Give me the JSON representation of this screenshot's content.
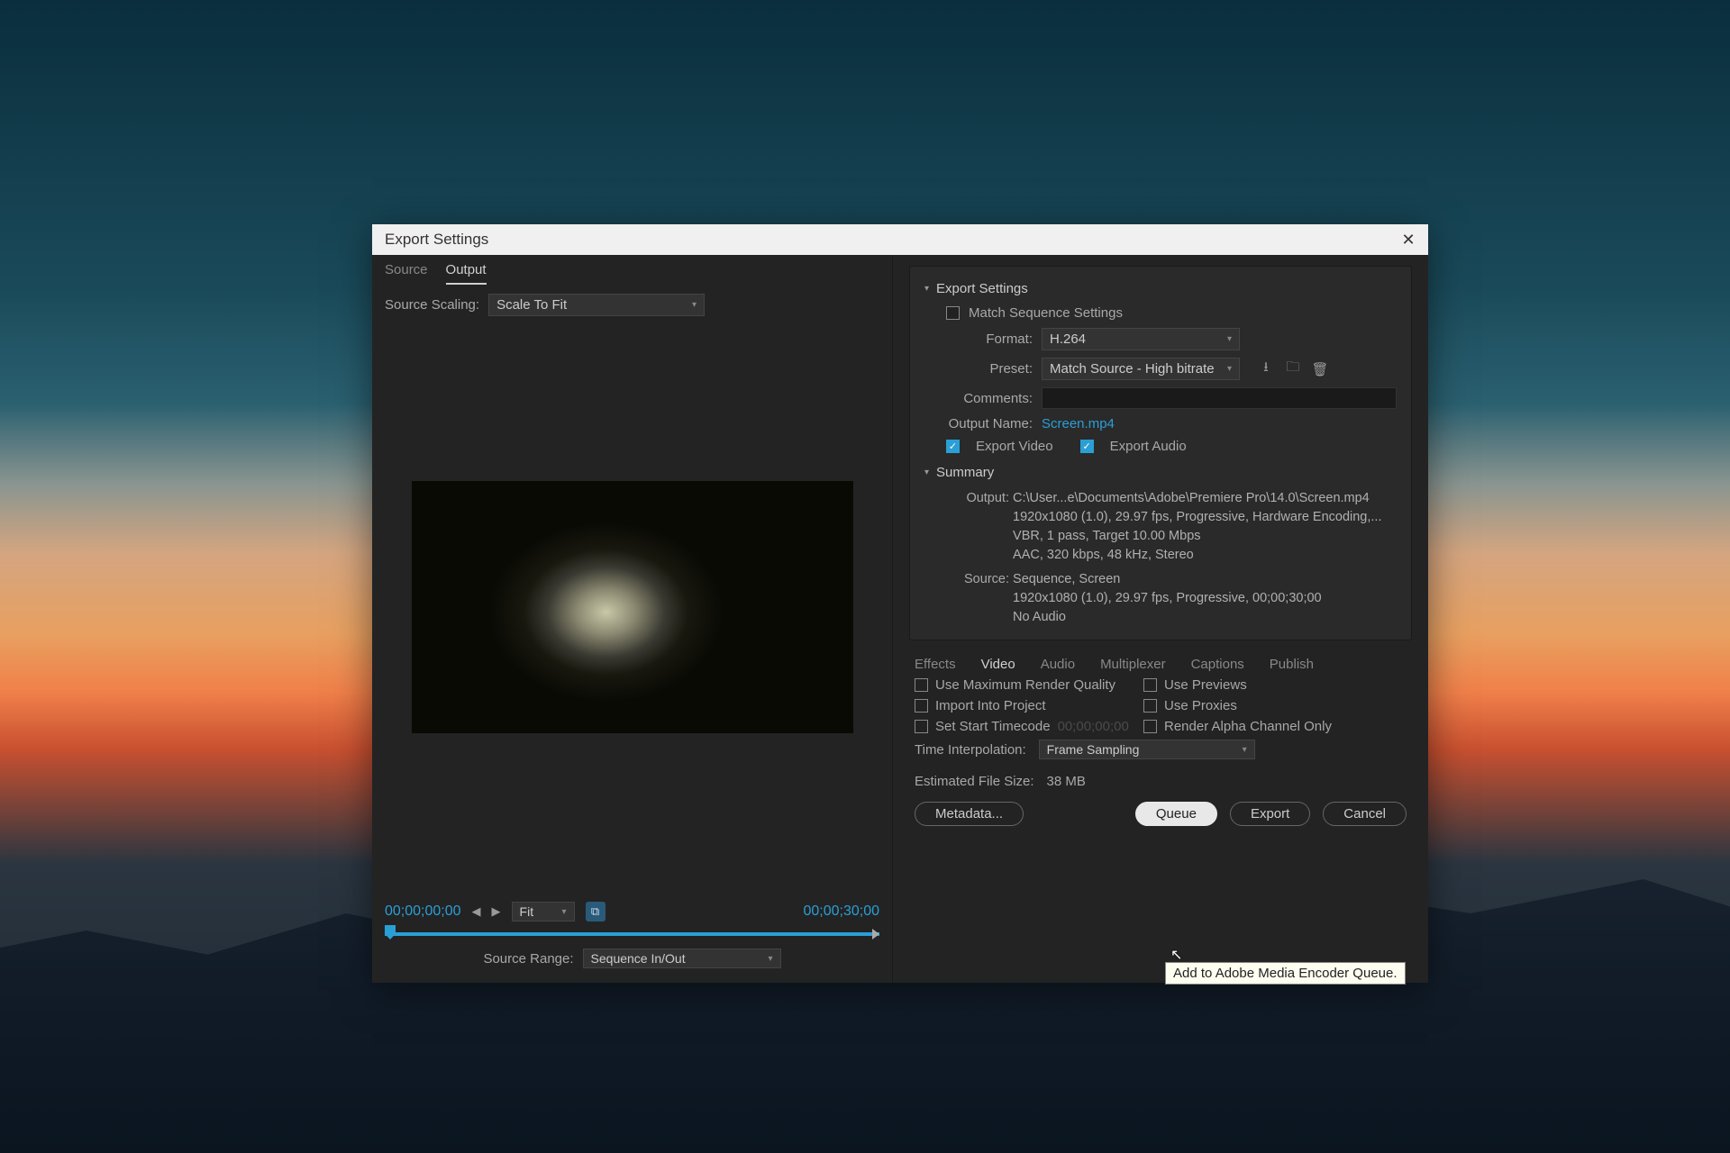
{
  "titlebar": {
    "title": "Export Settings"
  },
  "left": {
    "tabs": {
      "source": "Source",
      "output": "Output"
    },
    "sourceScalingLabel": "Source Scaling:",
    "sourceScalingValue": "Scale To Fit",
    "timecodeStart": "00;00;00;00",
    "timecodeEnd": "00;00;30;00",
    "fitLabel": "Fit",
    "sourceRangeLabel": "Source Range:",
    "sourceRangeValue": "Sequence In/Out"
  },
  "right": {
    "header": "Export Settings",
    "matchSeqLabel": "Match Sequence Settings",
    "formatLabel": "Format:",
    "formatValue": "H.264",
    "presetLabel": "Preset:",
    "presetValue": "Match Source - High bitrate",
    "commentsLabel": "Comments:",
    "outputNameLabel": "Output Name:",
    "outputNameValue": "Screen.mp4",
    "exportVideoLabel": "Export Video",
    "exportAudioLabel": "Export Audio",
    "summaryHeader": "Summary",
    "summaryOutputLabel": "Output:",
    "summaryOutputLines": "C:\\User...e\\Documents\\Adobe\\Premiere Pro\\14.0\\Screen.mp4\n1920x1080 (1.0), 29.97 fps, Progressive, Hardware Encoding,...\nVBR, 1 pass, Target 10.00 Mbps\nAAC, 320 kbps, 48 kHz, Stereo",
    "summarySourceLabel": "Source:",
    "summarySourceLines": "Sequence, Screen\n1920x1080 (1.0), 29.97 fps, Progressive, 00;00;30;00\nNo Audio",
    "midTabs": {
      "effects": "Effects",
      "video": "Video",
      "audio": "Audio",
      "multiplexer": "Multiplexer",
      "captions": "Captions",
      "publish": "Publish"
    },
    "opts": {
      "useMaxRender": "Use Maximum Render Quality",
      "usePreviews": "Use Previews",
      "importInto": "Import Into Project",
      "useProxies": "Use Proxies",
      "setStartTC": "Set Start Timecode",
      "startTCValue": "00;00;00;00",
      "renderAlpha": "Render Alpha Channel Only"
    },
    "timeInterpLabel": "Time Interpolation:",
    "timeInterpValue": "Frame Sampling",
    "estLabel": "Estimated File Size:",
    "estValue": "38 MB",
    "buttons": {
      "metadata": "Metadata...",
      "queue": "Queue",
      "export": "Export",
      "cancel": "Cancel"
    }
  },
  "tooltip": "Add to Adobe Media Encoder Queue."
}
